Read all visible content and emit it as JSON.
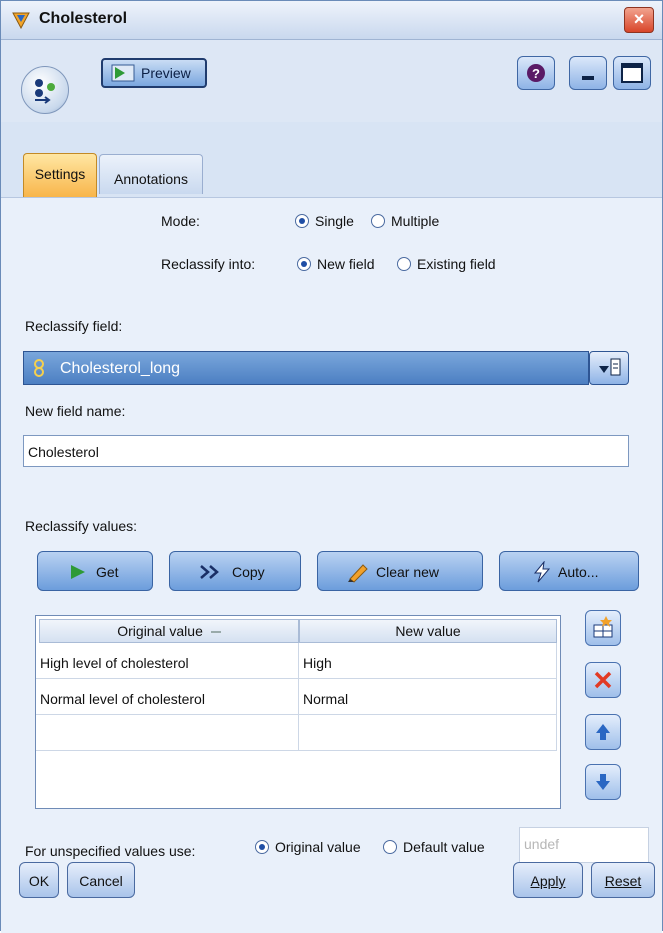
{
  "window": {
    "title": "Cholesterol",
    "close_glyph": "×"
  },
  "toolbar": {
    "preview_label": "Preview",
    "help_glyph": "?"
  },
  "tabs": [
    {
      "label": "Settings",
      "active": true
    },
    {
      "label": "Annotations",
      "active": false
    }
  ],
  "mode": {
    "label": "Mode:",
    "options": [
      "Single",
      "Multiple"
    ],
    "selected": "Single"
  },
  "reclassify_into": {
    "label": "Reclassify into:",
    "options": [
      "New field",
      "Existing field"
    ],
    "selected": "New field"
  },
  "reclassify_field": {
    "label": "Reclassify field:",
    "value": "Cholesterol_long"
  },
  "new_field_name": {
    "label": "New field name:",
    "value": "Cholesterol"
  },
  "reclassify_values": {
    "label": "Reclassify values:",
    "buttons": {
      "get": "Get",
      "copy": "Copy",
      "clear_new": "Clear new",
      "auto": "Auto..."
    },
    "columns": [
      "Original value",
      "New value"
    ],
    "rows": [
      [
        "High level of cholesterol",
        "High"
      ],
      [
        "Normal level of cholesterol",
        "Normal"
      ],
      [
        "",
        ""
      ]
    ]
  },
  "unspecified": {
    "label": "For unspecified values use:",
    "options": [
      "Original value",
      "Default value"
    ],
    "selected": "Original value",
    "default_placeholder": "undef"
  },
  "footer": {
    "ok": "OK",
    "cancel": "Cancel",
    "apply": "Apply",
    "reset": "Reset"
  },
  "colors": {
    "accent": "#f8b54a",
    "field_blue": "#4c7fc2",
    "close_red": "#d8452a"
  }
}
